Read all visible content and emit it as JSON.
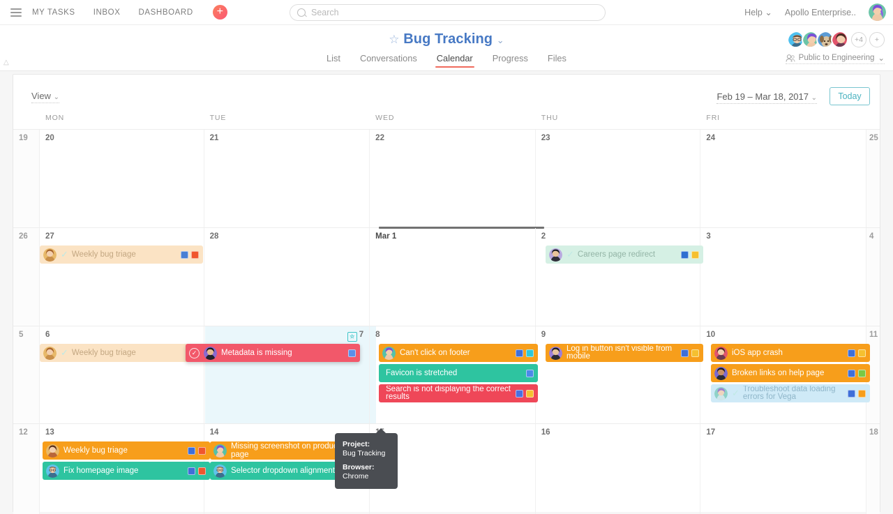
{
  "topbar": {
    "nav": [
      {
        "label": "MY TASKS"
      },
      {
        "label": "INBOX"
      },
      {
        "label": "DASHBOARD"
      }
    ],
    "add_label": "+",
    "search_placeholder": "Search",
    "search_value": "",
    "help_label": "Help",
    "org_label": "Apollo Enterprise..",
    "chevron": "⌄"
  },
  "project": {
    "star": "☆",
    "title": "Bug Tracking",
    "chevron": "⌄",
    "tabs": [
      {
        "label": "List",
        "active": false
      },
      {
        "label": "Conversations",
        "active": false
      },
      {
        "label": "Calendar",
        "active": true
      },
      {
        "label": "Progress",
        "active": false
      },
      {
        "label": "Files",
        "active": false
      }
    ],
    "members_overflow": "+4",
    "members_add": "+",
    "privacy_label": "Public to Engineering",
    "privacy_chevron": "⌄"
  },
  "calendar": {
    "view_label": "View",
    "view_chevron": "⌄",
    "range_label": "Feb 19 – Mar 18, 2017",
    "range_chevron": "⌄",
    "today_label": "Today",
    "day_headers": [
      "MON",
      "TUE",
      "WED",
      "THU",
      "FRI"
    ],
    "weeks": [
      {
        "days": [
          "19",
          "20",
          "21",
          "22",
          "23",
          "24",
          "25"
        ],
        "events": []
      },
      {
        "days": [
          "26",
          "27",
          "28",
          "Mar 1",
          "2",
          "3",
          "4"
        ],
        "events": [
          {
            "label": "Weekly bug triage",
            "style": "fadeorange",
            "tags": [
              "#4a7fd4",
              "#f0562e"
            ],
            "completed": true
          },
          {
            "label": "Careers page redirect",
            "style": "fadeteal",
            "tags": [
              "#2f6fd0",
              "#f5c030"
            ],
            "completed": true
          }
        ]
      },
      {
        "days": [
          "5",
          "6",
          "7",
          "8",
          "9",
          "10",
          "11"
        ],
        "today": "7",
        "events": [
          {
            "label": "Weekly bug triage",
            "style": "fadeorange",
            "tags": [],
            "completed": true
          },
          {
            "label": "Metadata is missing",
            "style": "pink",
            "tags": [
              "#5b8fe8"
            ],
            "completed": false
          },
          {
            "label": "Can't click on footer",
            "style": "orange",
            "tags": [
              "#3f6fd8",
              "#2ec8d8"
            ],
            "completed": false
          },
          {
            "label": "Favicon is stretched",
            "style": "teal",
            "tags": [
              "#4b8ae8"
            ],
            "completed": false
          },
          {
            "label": "Search is not displaying the correct results",
            "style": "red",
            "tags": [
              "#4a6fe0",
              "#f5c030"
            ],
            "completed": false
          },
          {
            "label": "Log in button isn't visible from mobile",
            "style": "orange",
            "tags": [
              "#3f6fd8",
              "#f5c030"
            ],
            "completed": false
          },
          {
            "label": "iOS app crash",
            "style": "orange",
            "tags": [
              "#3f6fd8",
              "#f5c030"
            ],
            "completed": false
          },
          {
            "label": "Broken links on help page",
            "style": "orange",
            "tags": [
              "#3f6fd8",
              "#7ac943"
            ],
            "completed": false
          },
          {
            "label": "Troubleshoot data loading errors for Vega",
            "style": "fadeblue",
            "tags": [
              "#3f6fd8",
              "#f79e1b"
            ],
            "completed": true
          }
        ]
      },
      {
        "days": [
          "12",
          "13",
          "14",
          "15",
          "16",
          "17",
          "18"
        ],
        "events": [
          {
            "label": "Weekly bug triage",
            "style": "orange",
            "tags": [
              "#3f6fd8",
              "#f0562e"
            ],
            "completed": false
          },
          {
            "label": "Fix homepage image",
            "style": "teal",
            "tags": [
              "#3f6fd8",
              "#f0562e"
            ],
            "completed": false
          },
          {
            "label": "Missing screenshot on product page",
            "style": "orange",
            "tags": [
              "#3f6fd8",
              "#2ec8d8"
            ],
            "completed": false
          },
          {
            "label": "Selector dropdown alignment off",
            "style": "teal",
            "tags": [
              "#4b8ae8"
            ],
            "completed": false
          }
        ]
      }
    ]
  },
  "tooltip": {
    "project_key": "Project:",
    "project_value": "Bug Tracking",
    "browser_key": "Browser:",
    "browser_value": "Chrome"
  },
  "colors": {
    "accent_blue": "#4779c4",
    "tab_underline": "#f06a5d",
    "today_border": "#79c5cf",
    "orange": "#f79e1b",
    "teal": "#2ec4a0",
    "red": "#ef4758",
    "pink": "#f2586a"
  }
}
